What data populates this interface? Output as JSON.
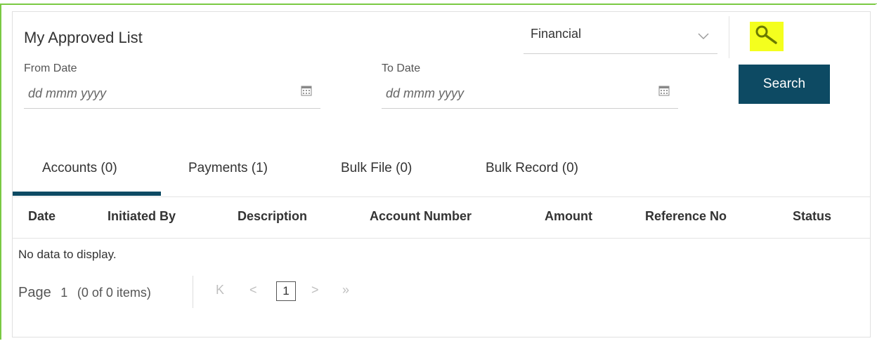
{
  "header": {
    "title": "My Approved List"
  },
  "type_select": {
    "value": "Financial"
  },
  "filters": {
    "from_label": "From Date",
    "from_placeholder": "dd mmm yyyy",
    "to_label": "To Date",
    "to_placeholder": "dd mmm yyyy",
    "search_label": "Search"
  },
  "tabs": [
    {
      "label": "Accounts (0)",
      "active": true
    },
    {
      "label": "Payments (1)",
      "active": false
    },
    {
      "label": "Bulk File (0)",
      "active": false
    },
    {
      "label": "Bulk Record (0)",
      "active": false
    }
  ],
  "table": {
    "columns": [
      "Date",
      "Initiated By",
      "Description",
      "Account Number",
      "Amount",
      "Reference No",
      "Status"
    ],
    "empty_text": "No data to display."
  },
  "pager": {
    "page_word": "Page",
    "page_number": "1",
    "items_text": "(0 of 0 items)",
    "current_page": "1",
    "first_glyph": "K",
    "prev_glyph": "<",
    "next_glyph": ">",
    "last_glyph": "»"
  },
  "colors": {
    "accent": "#0d4a63",
    "highlight": "#f4ff1e",
    "frame": "#7ac943"
  },
  "icons": {
    "search_key": "magnifier-icon",
    "dropdown": "chevron-down-icon",
    "calendar": "calendar-icon"
  }
}
